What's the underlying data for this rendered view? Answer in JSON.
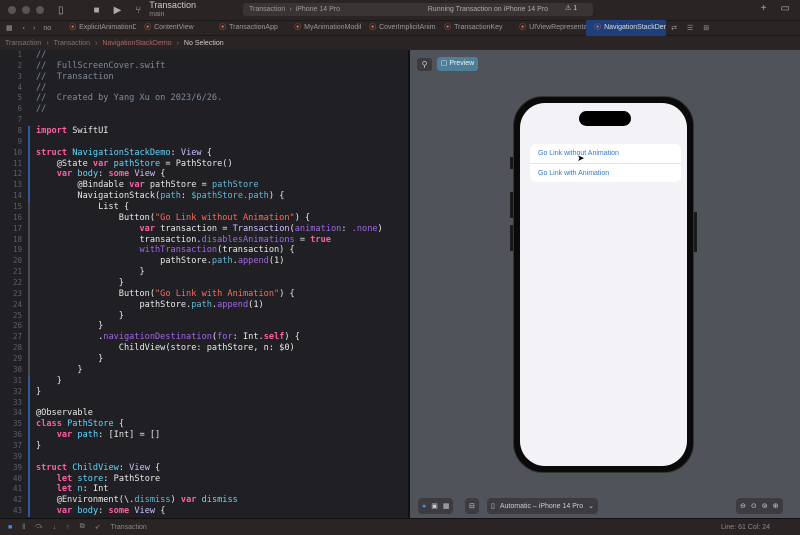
{
  "titlebar": {
    "project": "Transaction",
    "branch": "main",
    "scheme": "Transaction",
    "device": "iPhone 14 Pro",
    "run_status": "Running Transaction on iPhone 14 Pro",
    "warnings": "1"
  },
  "tabs": [
    "ExplicitAnimationDemo",
    "ContentView",
    "TransactionApp",
    "MyAnimationModifier",
    "CoverImplicitAnimation",
    "TransactionKey",
    "UIViewRepresentable",
    "NavigationStackDem"
  ],
  "tabs_prefix": "no",
  "breadcrumb": [
    "Transaction",
    "Transaction",
    "NavigationStackDemo",
    "No Selection"
  ],
  "code_lines": [
    [
      [
        "comment",
        "//"
      ]
    ],
    [
      [
        "comment",
        "//  FullScreenCover.swift"
      ]
    ],
    [
      [
        "comment",
        "//  Transaction"
      ]
    ],
    [
      [
        "comment",
        "//"
      ]
    ],
    [
      [
        "comment",
        "//  Created by Yang Xu on 2023/6/26."
      ]
    ],
    [
      [
        "comment",
        "//"
      ]
    ],
    [],
    [
      [
        "kw",
        "import"
      ],
      [
        "p",
        " SwiftUI"
      ]
    ],
    [],
    [
      [
        "kw",
        "struct"
      ],
      [
        "p",
        " "
      ],
      [
        "decl",
        "NavigationStackDemo"
      ],
      [
        "p",
        ": "
      ],
      [
        "type",
        "View"
      ],
      [
        "p",
        " {"
      ]
    ],
    [
      [
        "p",
        "    @State "
      ],
      [
        "kw",
        "var"
      ],
      [
        "p",
        " "
      ],
      [
        "decl",
        "pathStore"
      ],
      [
        "p",
        " = PathStore()"
      ]
    ],
    [
      [
        "p",
        "    "
      ],
      [
        "kw",
        "var"
      ],
      [
        "p",
        " "
      ],
      [
        "decl",
        "body"
      ],
      [
        "p",
        ": "
      ],
      [
        "kw",
        "some"
      ],
      [
        "p",
        " "
      ],
      [
        "type",
        "View"
      ],
      [
        "p",
        " {"
      ]
    ],
    [
      [
        "p",
        "        @Bindable "
      ],
      [
        "kw",
        "var"
      ],
      [
        "p",
        " pathStore = "
      ],
      [
        "prop",
        "pathStore"
      ]
    ],
    [
      [
        "p",
        "        NavigationStack("
      ],
      [
        "prop",
        "path"
      ],
      [
        "p",
        ": "
      ],
      [
        "prop",
        "$pathStore.path"
      ],
      [
        "p",
        ") {"
      ]
    ],
    [
      [
        "p",
        "            List {"
      ]
    ],
    [
      [
        "p",
        "                Button("
      ],
      [
        "str",
        "\"Go Link without Animation\""
      ],
      [
        "p",
        ") {"
      ]
    ],
    [
      [
        "p",
        "                    "
      ],
      [
        "kw",
        "var"
      ],
      [
        "p",
        " transaction = "
      ],
      [
        "type",
        "Transaction"
      ],
      [
        "p",
        "("
      ],
      [
        "fn",
        "animation"
      ],
      [
        "p",
        ": "
      ],
      [
        "fn",
        ".none"
      ],
      [
        "p",
        ")"
      ]
    ],
    [
      [
        "p",
        "                    transaction."
      ],
      [
        "fn",
        "disablesAnimations"
      ],
      [
        "p",
        " = "
      ],
      [
        "kw",
        "true"
      ]
    ],
    [
      [
        "p",
        "                    "
      ],
      [
        "fn",
        "withTransaction"
      ],
      [
        "p",
        "(transaction) {"
      ]
    ],
    [
      [
        "p",
        "                        pathStore."
      ],
      [
        "prop",
        "path"
      ],
      [
        "p",
        "."
      ],
      [
        "fn",
        "append"
      ],
      [
        "p",
        "(1)"
      ]
    ],
    [
      [
        "p",
        "                    }"
      ]
    ],
    [
      [
        "p",
        "                }"
      ]
    ],
    [
      [
        "p",
        "                Button("
      ],
      [
        "str",
        "\"Go Link with Animation\""
      ],
      [
        "p",
        ") {"
      ]
    ],
    [
      [
        "p",
        "                    pathStore."
      ],
      [
        "prop",
        "path"
      ],
      [
        "p",
        "."
      ],
      [
        "fn",
        "append"
      ],
      [
        "p",
        "(1)"
      ]
    ],
    [
      [
        "p",
        "                }"
      ]
    ],
    [
      [
        "p",
        "            }"
      ]
    ],
    [
      [
        "p",
        "            ."
      ],
      [
        "fn",
        "navigationDestination"
      ],
      [
        "p",
        "("
      ],
      [
        "fn",
        "for"
      ],
      [
        "p",
        ": Int."
      ],
      [
        "kw",
        "self"
      ],
      [
        "p",
        ") {"
      ]
    ],
    [
      [
        "p",
        "                ChildView(store: pathStore, n: $0)"
      ]
    ],
    [
      [
        "p",
        "            }"
      ]
    ],
    [
      [
        "p",
        "        }"
      ]
    ],
    [
      [
        "p",
        "    }"
      ]
    ],
    [
      [
        "p",
        "}"
      ]
    ],
    [],
    [
      [
        "p",
        "@Observable"
      ]
    ],
    [
      [
        "kw",
        "class"
      ],
      [
        "p",
        " "
      ],
      [
        "decl",
        "PathStore"
      ],
      [
        "p",
        " {"
      ]
    ],
    [
      [
        "p",
        "    "
      ],
      [
        "kw",
        "var"
      ],
      [
        "p",
        " "
      ],
      [
        "decl",
        "path"
      ],
      [
        "p",
        ": [Int] = []"
      ]
    ],
    [
      [
        "p",
        "}"
      ]
    ],
    [],
    [
      [
        "kw",
        "struct"
      ],
      [
        "p",
        " "
      ],
      [
        "decl",
        "ChildView"
      ],
      [
        "p",
        ": "
      ],
      [
        "type",
        "View"
      ],
      [
        "p",
        " {"
      ]
    ],
    [
      [
        "p",
        "    "
      ],
      [
        "kw",
        "let"
      ],
      [
        "p",
        " "
      ],
      [
        "decl",
        "store"
      ],
      [
        "p",
        ": PathStore"
      ]
    ],
    [
      [
        "p",
        "    "
      ],
      [
        "kw",
        "let"
      ],
      [
        "p",
        " "
      ],
      [
        "decl",
        "n"
      ],
      [
        "p",
        ": Int"
      ]
    ],
    [
      [
        "p",
        "    @Environment(\\."
      ],
      [
        "prop",
        "dismiss"
      ],
      [
        "p",
        ") "
      ],
      [
        "kw",
        "var"
      ],
      [
        "p",
        " "
      ],
      [
        "decl",
        "dismiss"
      ]
    ],
    [
      [
        "p",
        "    "
      ],
      [
        "kw",
        "var"
      ],
      [
        "p",
        " "
      ],
      [
        "decl",
        "body"
      ],
      [
        "p",
        ": "
      ],
      [
        "kw",
        "some"
      ],
      [
        "p",
        " "
      ],
      [
        "type",
        "View"
      ],
      [
        "p",
        " {"
      ]
    ]
  ],
  "line_numbers": [
    "1",
    "2",
    "3",
    "4",
    "5",
    "6",
    "7",
    "8",
    "9",
    "10",
    "11",
    "12",
    "13",
    "14",
    "15",
    "16",
    "17",
    "18",
    "19",
    "20",
    "21",
    "22",
    "23",
    "24",
    "25",
    "26",
    "27",
    "28",
    "29",
    "30",
    "31",
    "32",
    "33",
    "34",
    "35",
    "36",
    "37",
    "39",
    "39",
    "40",
    "41",
    "42",
    "43"
  ],
  "preview": {
    "button_label": "Preview",
    "list_items": [
      "Go Link without Animation",
      "Go Link with Animation"
    ],
    "device_selector": "Automatic – iPhone 14 Pro"
  },
  "status": {
    "scheme": "Transaction",
    "position": "Line: 61  Col: 24"
  }
}
